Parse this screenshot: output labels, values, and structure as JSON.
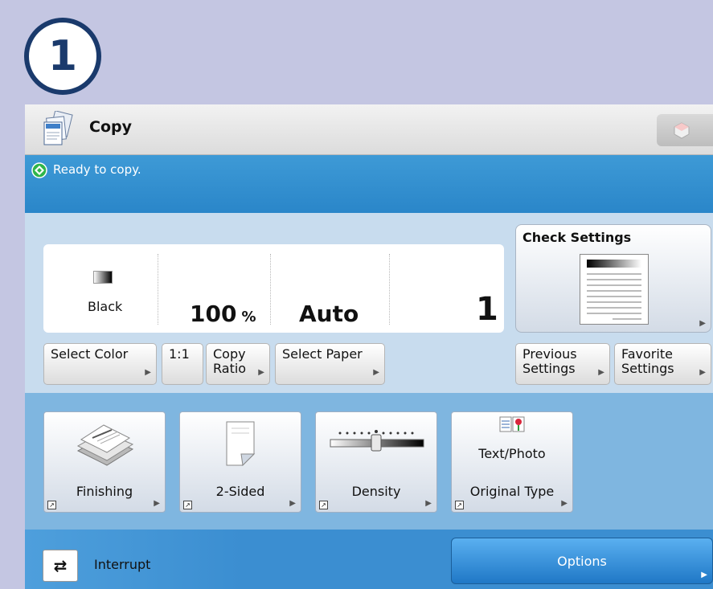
{
  "step_number": "1",
  "app": {
    "title": "Copy",
    "icon": "copy-documents-icon"
  },
  "status": {
    "text": "Ready to copy.",
    "icon": "ready-status-icon"
  },
  "summary": {
    "color_value": "Black",
    "ratio_value": "100",
    "ratio_unit": "%",
    "paper_value": "Auto",
    "copies": "1"
  },
  "buttons": {
    "select_color": "Select Color",
    "ratio_1to1": "1:1",
    "copy_ratio_line1": "Copy",
    "copy_ratio_line2": "Ratio",
    "select_paper": "Select Paper",
    "check_settings": "Check Settings",
    "previous_line1": "Previous",
    "previous_line2": "Settings",
    "favorite_line1": "Favorite",
    "favorite_line2": "Settings"
  },
  "functions": [
    {
      "label": "Finishing",
      "icon": "finishing-icon"
    },
    {
      "label": "2-Sided",
      "icon": "two-sided-icon"
    },
    {
      "label": "Density",
      "icon": "density-slider-icon"
    },
    {
      "label": "Original Type",
      "icon": "original-type-icon",
      "value": "Text/Photo"
    }
  ],
  "footer": {
    "interrupt": "Interrupt",
    "options": "Options"
  },
  "colors": {
    "status_bar": "#2a86c9",
    "badge": "#1a3a6c",
    "function_area": "#7fb6e0"
  }
}
